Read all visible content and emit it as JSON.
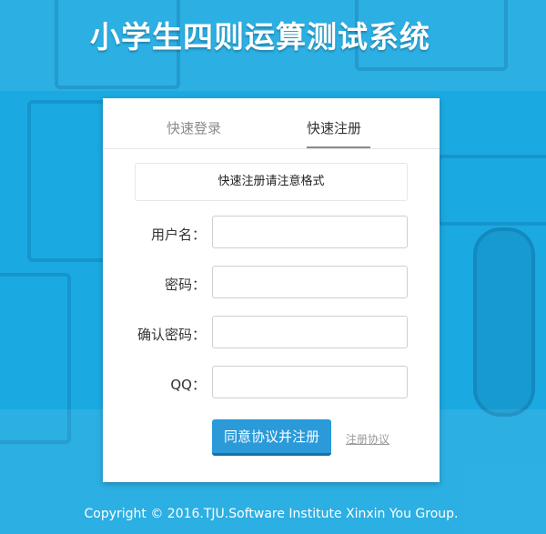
{
  "header": {
    "title": "小学生四则运算测试系统"
  },
  "tabs": [
    {
      "label": "快速登录",
      "active": false
    },
    {
      "label": "快速注册",
      "active": true
    }
  ],
  "form": {
    "notice": "快速注册请注意格式",
    "fields": [
      {
        "label": "用户名：",
        "value": "",
        "placeholder": ""
      },
      {
        "label": "密码：",
        "value": "",
        "placeholder": ""
      },
      {
        "label": "确认密码：",
        "value": "",
        "placeholder": ""
      },
      {
        "label": "QQ：",
        "value": "",
        "placeholder": ""
      }
    ],
    "submit_label": "同意协议并注册",
    "agreement_link": "注册协议"
  },
  "footer": {
    "copyright": "Copyright © 2016.TJU.Software Institute Xinxin You Group."
  },
  "colors": {
    "background": "#1ba9e1",
    "button": "#2a9ad9",
    "panel": "#ffffff"
  }
}
